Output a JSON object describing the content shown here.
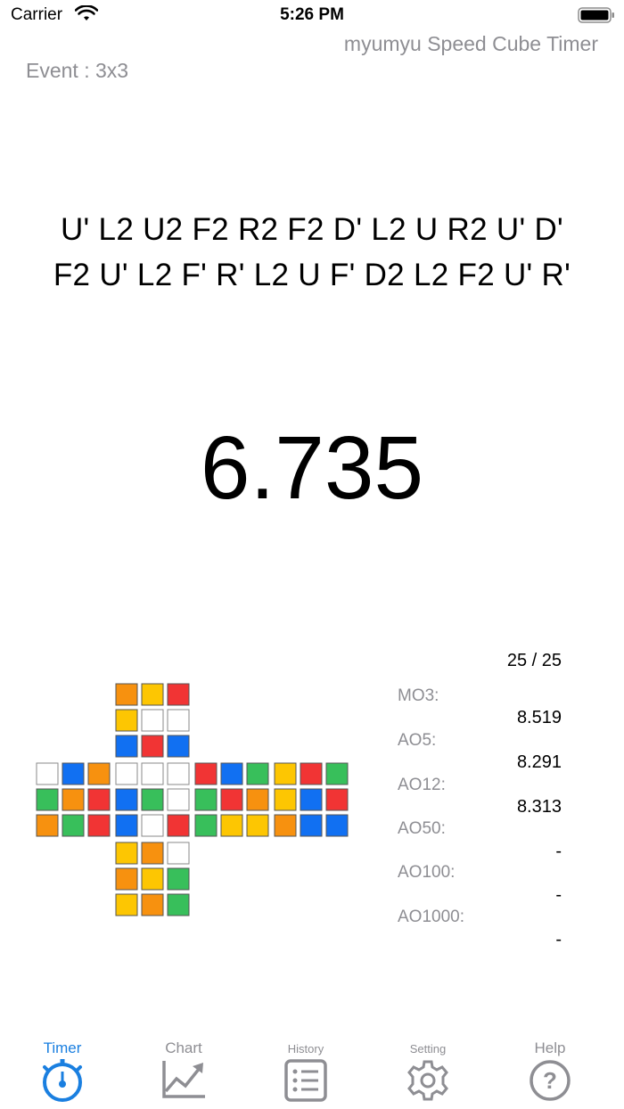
{
  "status_bar": {
    "carrier": "Carrier",
    "time": "5:26 PM"
  },
  "header": {
    "app_title": "myumyu Speed Cube Timer",
    "event_label": "Event : 3x3"
  },
  "scramble": {
    "line1": "U' L2 U2 F2 R2 F2 D' L2 U R2 U' D'",
    "line2": "F2 U' L2 F' R' L2 U F' D2 L2 F2 U' R'"
  },
  "timer": {
    "value": "6.735"
  },
  "colors": {
    "O": "#f7910f",
    "Y": "#fdc602",
    "R": "#f13434",
    "B": "#1170f2",
    "G": "#38bf5b",
    "W": "#ffffff",
    "accent": "#1a7fe0",
    "gray": "#8e8e93"
  },
  "cube_net": {
    "U": [
      "OYR",
      "YWW",
      "BRB"
    ],
    "L": [
      "WBO",
      "GOR",
      "OGR"
    ],
    "F": [
      "WWW",
      "BGW",
      "BWR"
    ],
    "R": [
      "RBG",
      "GRO",
      "GYY"
    ],
    "B": [
      "YRG",
      "YBR",
      "OBB"
    ],
    "D": [
      "YOW",
      "OYG",
      "YOG"
    ]
  },
  "stats": {
    "count": "25 / 25",
    "items": [
      {
        "label": "MO3:",
        "value": "8.519"
      },
      {
        "label": "AO5:",
        "value": "8.291"
      },
      {
        "label": "AO12:",
        "value": "8.313"
      },
      {
        "label": "AO50:",
        "value": "-"
      },
      {
        "label": "AO100:",
        "value": "-"
      },
      {
        "label": "AO1000:",
        "value": "-"
      }
    ]
  },
  "tabs": [
    {
      "label": "Timer",
      "icon": "stopwatch-icon",
      "active": true
    },
    {
      "label": "Chart",
      "icon": "chart-icon",
      "active": false
    },
    {
      "label": "History",
      "icon": "list-icon",
      "active": false
    },
    {
      "label": "Setting",
      "icon": "gear-icon",
      "active": false
    },
    {
      "label": "Help",
      "icon": "help-icon",
      "active": false
    }
  ]
}
